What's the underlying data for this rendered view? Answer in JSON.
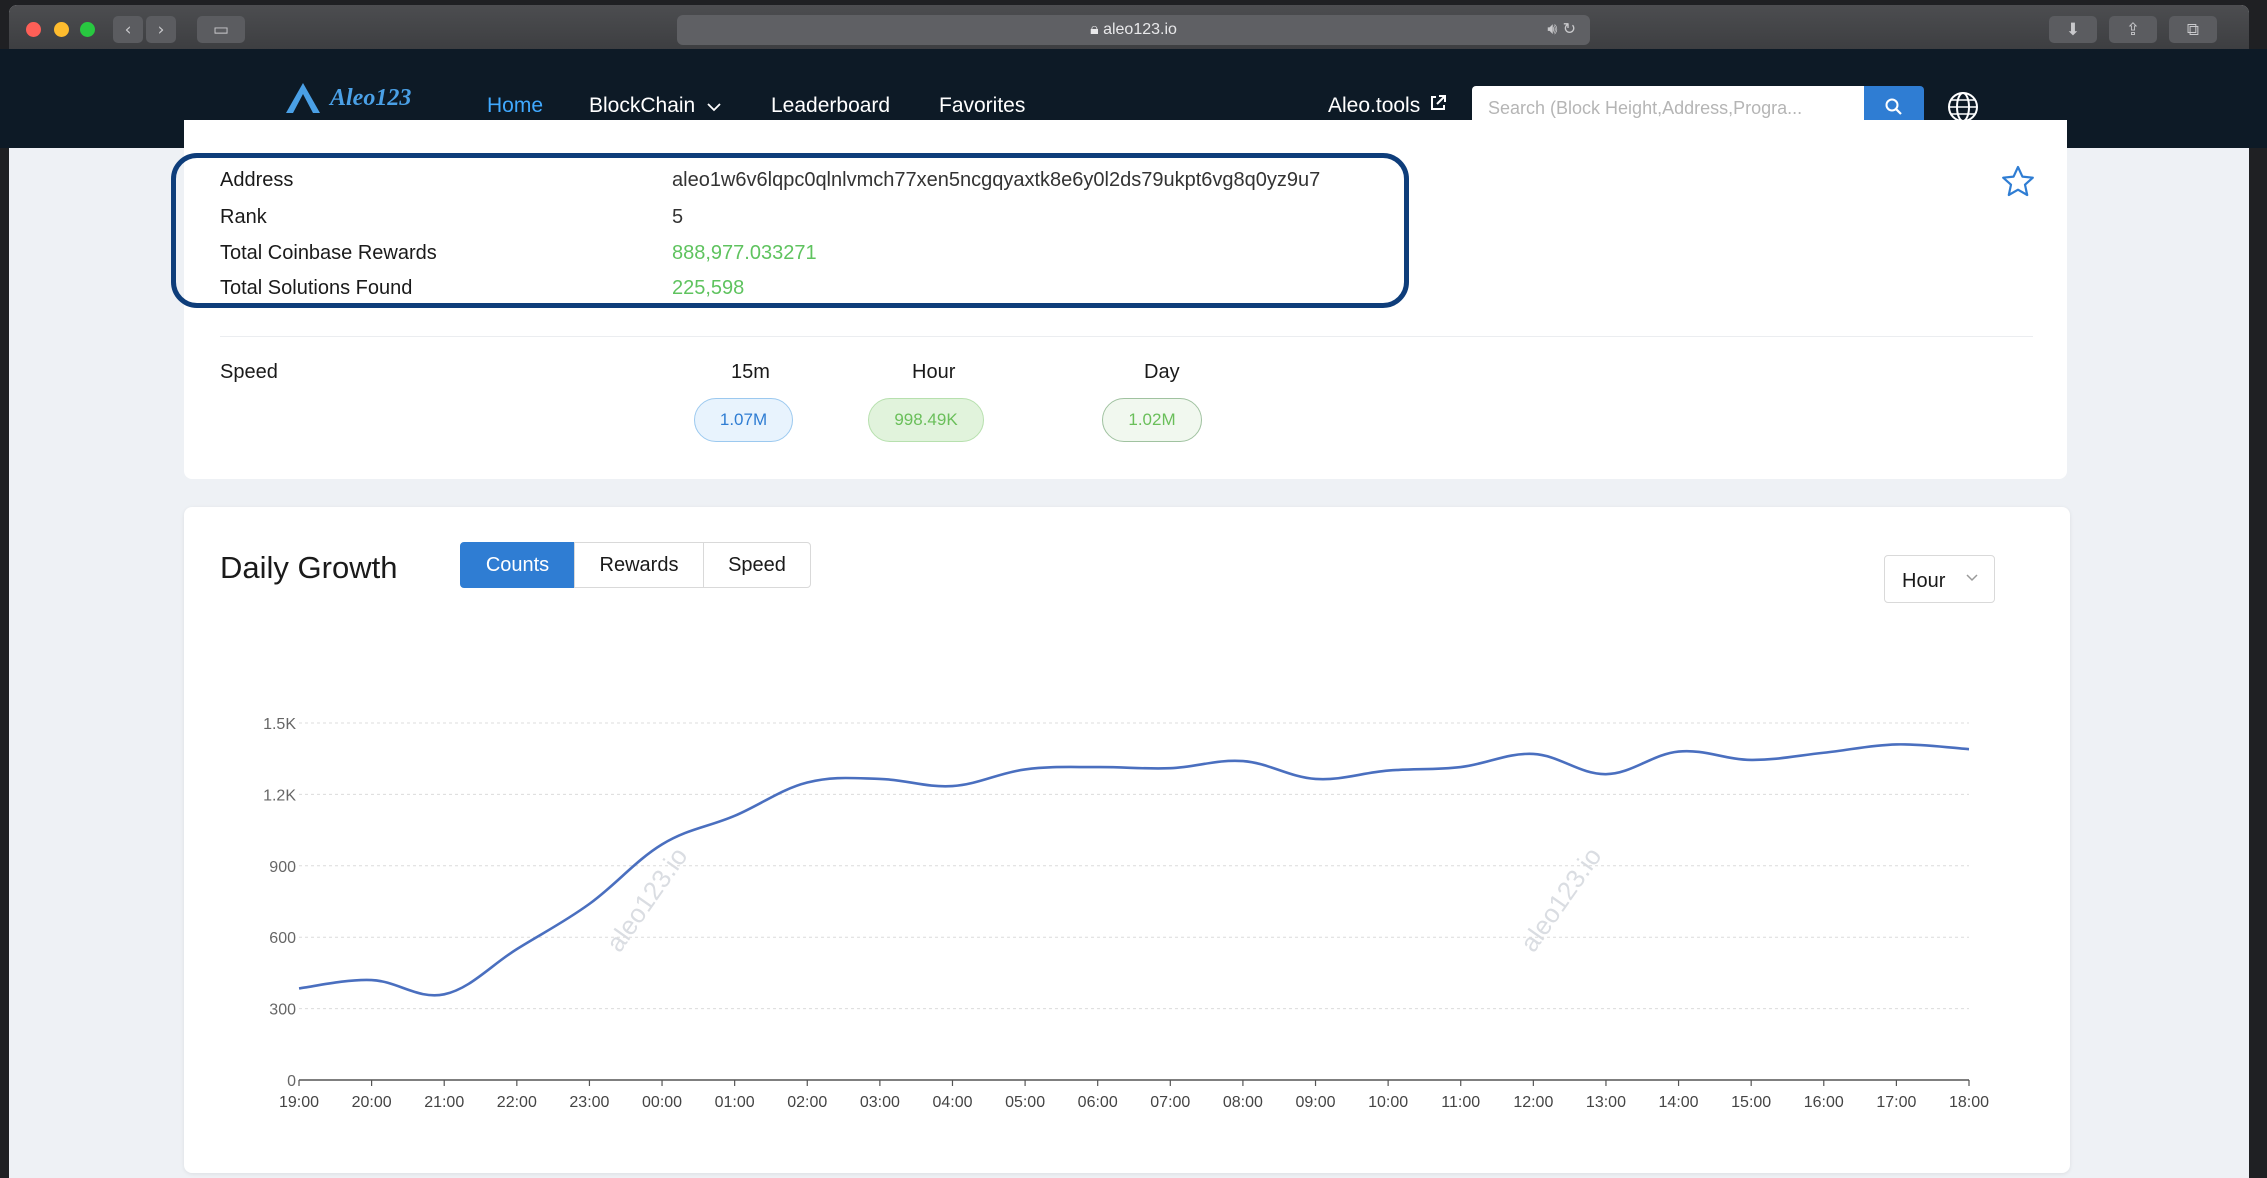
{
  "browser": {
    "url": "aleo123.io"
  },
  "nav": {
    "logo": "Aleo123",
    "items": [
      "Home",
      "BlockChain",
      "Leaderboard",
      "Favorites"
    ],
    "external_link": "Aleo.tools",
    "search_placeholder": "Search (Block Height,Address,Progra..."
  },
  "info": {
    "rows": [
      {
        "label": "Address",
        "value": "aleo1w6v6lqpc0qlnlvmch77xen5ncgqyaxtk8e6y0l2ds79ukpt6vg8q0yz9u7"
      },
      {
        "label": "Rank",
        "value": "5"
      },
      {
        "label": "Total Coinbase Rewards",
        "value": "888,977.033271"
      },
      {
        "label": "Total Solutions Found",
        "value": "225,598"
      }
    ]
  },
  "speed": {
    "label": "Speed",
    "headers": [
      "15m",
      "Hour",
      "Day"
    ],
    "values": [
      "1.07M",
      "998.49K",
      "1.02M"
    ]
  },
  "daily_growth": {
    "title": "Daily Growth",
    "tabs": [
      "Counts",
      "Rewards",
      "Speed"
    ],
    "active_tab": "Counts",
    "interval": "Hour",
    "watermark": "aleo123.io"
  },
  "colors": {
    "accent": "#2f7dd3",
    "nav_bg": "#0d1a26",
    "positive": "#5fc35f",
    "line": "#4a6fbf"
  },
  "chart_data": {
    "type": "line",
    "x": [
      "19:00",
      "20:00",
      "21:00",
      "22:00",
      "23:00",
      "00:00",
      "01:00",
      "02:00",
      "03:00",
      "04:00",
      "05:00",
      "06:00",
      "07:00",
      "08:00",
      "09:00",
      "10:00",
      "11:00",
      "12:00",
      "13:00",
      "14:00",
      "15:00",
      "16:00",
      "17:00",
      "18:00"
    ],
    "series": [
      {
        "values": [
          385,
          420,
          360,
          550,
          740,
          990,
          1110,
          1250,
          1265,
          1235,
          1305,
          1315,
          1310,
          1340,
          1265,
          1300,
          1315,
          1370,
          1285,
          1380,
          1345,
          1375,
          1410,
          1390
        ]
      }
    ],
    "yticks": [
      "0",
      "300",
      "600",
      "900",
      "1.2K",
      "1.5K"
    ],
    "ylim": [
      0,
      1500
    ],
    "grid": true
  }
}
